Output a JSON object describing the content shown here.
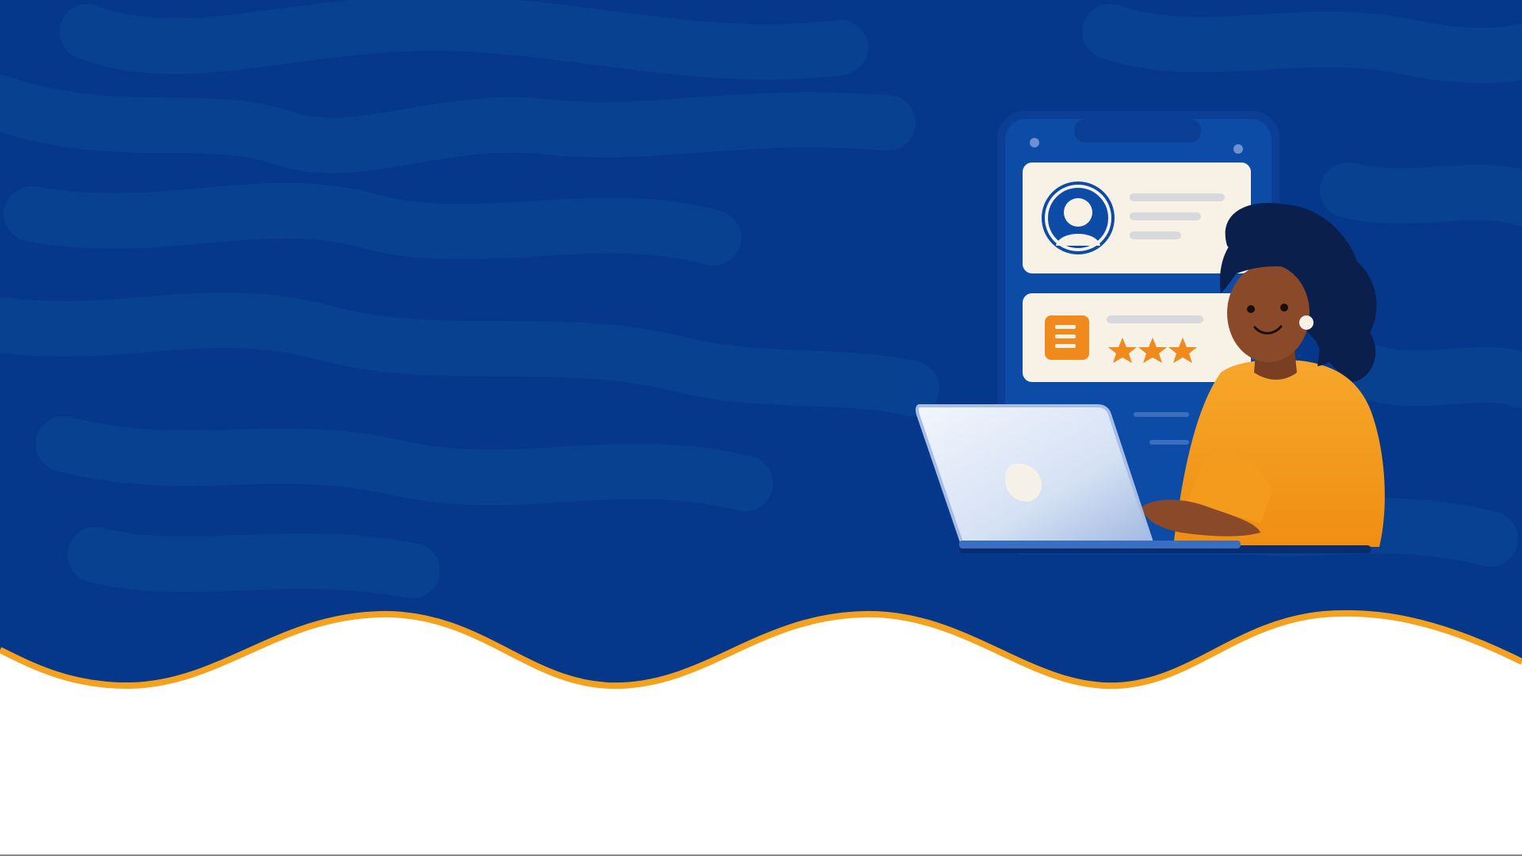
{
  "theme": {
    "background_blue": "#05378a",
    "pattern_blue": "#0a4393",
    "wave_orange": "#f4a11f",
    "page_white": "#ffffff",
    "phone_blue": "#0c4ca6",
    "card_cream": "#f7f1e6",
    "accent_orange": "#f08a1c",
    "shirt_orange": "#f49a1d",
    "skin_brown": "#8a4a2a",
    "hair_navy": "#0b1f4d",
    "laptop_silver": "#d9e4f5"
  },
  "illustration": {
    "phone_icon": "smartphone-icon",
    "profile_icon": "user-avatar-icon",
    "document_icon": "document-icon",
    "rating_icon": "star-icon",
    "laptop_icon": "laptop-icon",
    "person_icon": "woman-using-laptop-icon",
    "rating": 3,
    "rating_max": 3
  }
}
